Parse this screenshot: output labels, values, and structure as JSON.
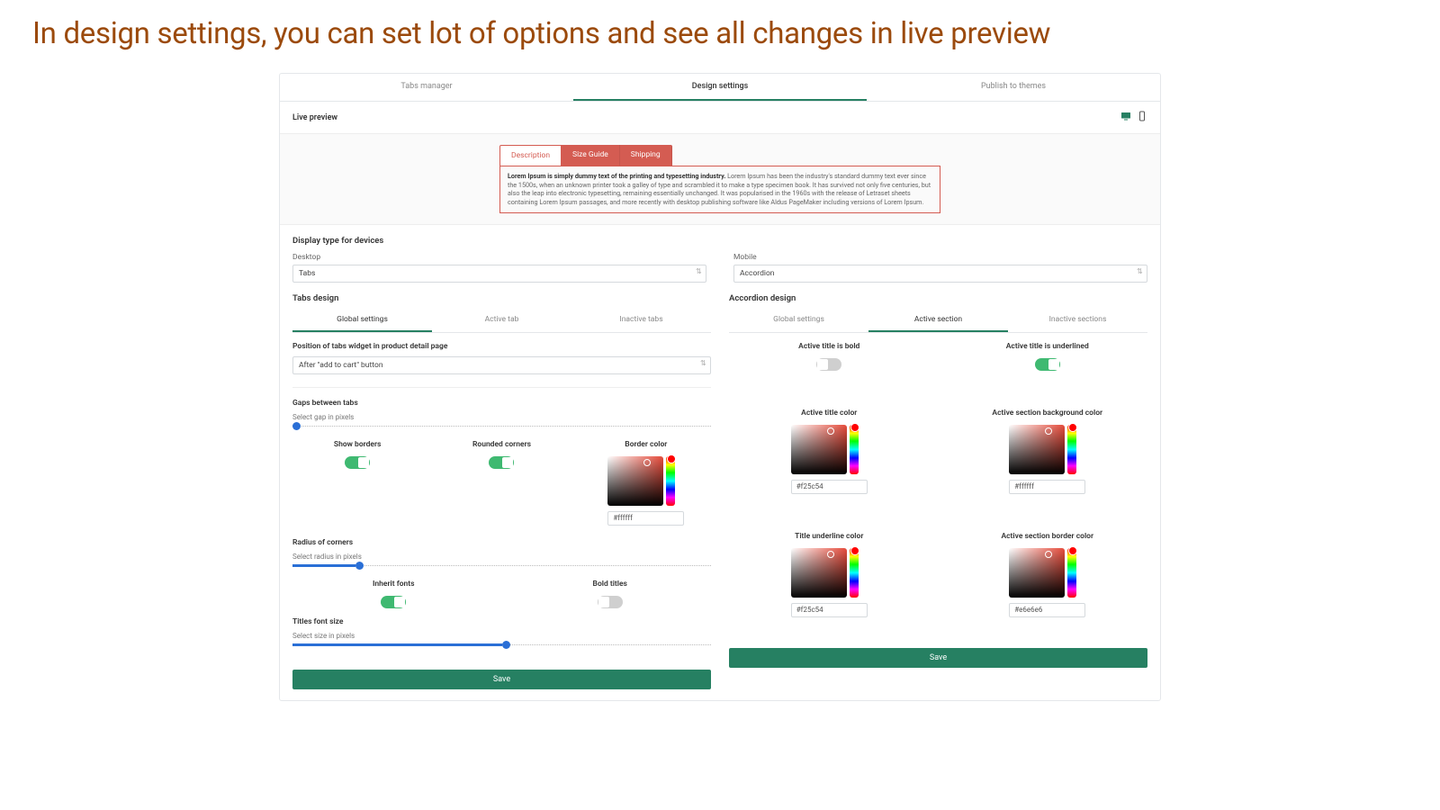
{
  "hero": "In design settings, you can set lot of options and see all changes in live preview",
  "top_tabs": {
    "a": "Tabs manager",
    "b": "Design settings",
    "c": "Publish to themes"
  },
  "live_preview": {
    "title": "Live preview"
  },
  "preview": {
    "tabs": {
      "a": "Description",
      "b": "Size Guide",
      "c": "Shipping"
    },
    "lead": "Lorem Ipsum is simply dummy text of the printing and typesetting industry.",
    "body": " Lorem Ipsum has been the industry's standard dummy text ever since the 1500s, when an unknown printer took a galley of type and scrambled it to make a type specimen book. It has survived not only five centuries, but also the leap into electronic typesetting, remaining essentially unchanged. It was popularised in the 1960s with the release of Letraset sheets containing Lorem Ipsum passages, and more recently with desktop publishing software like Aldus PageMaker including versions of Lorem Ipsum."
  },
  "display_type": {
    "title": "Display type for devices",
    "desktop_lbl": "Desktop",
    "desktop_val": "Tabs",
    "mobile_lbl": "Mobile",
    "mobile_val": "Accordion"
  },
  "tabs_design": {
    "title": "Tabs design",
    "subtabs": {
      "a": "Global settings",
      "b": "Active tab",
      "c": "Inactive tabs"
    },
    "position_title": "Position of tabs widget in product detail page",
    "position_val": "After \"add to cart\" button",
    "gaps_title": "Gaps between tabs",
    "gaps_lbl": "Select gap in pixels",
    "show_borders": "Show borders",
    "rounded": "Rounded corners",
    "border_color": "Border color",
    "border_color_val": "#ffffff",
    "radius_title": "Radius of corners",
    "radius_lbl": "Select radius in pixels",
    "inherit": "Inherit fonts",
    "bold_titles": "Bold titles",
    "font_title": "Titles font size",
    "font_lbl": "Select size in pixels",
    "save": "Save"
  },
  "accordion": {
    "title": "Accordion design",
    "subtabs": {
      "a": "Global settings",
      "b": "Active section",
      "c": "Inactive sections"
    },
    "bold_title": "Active title is bold",
    "underline_title": "Active title is underlined",
    "title_color": "Active title color",
    "title_color_val": "#f25c54",
    "bg_color": "Active section background color",
    "bg_color_val": "#ffffff",
    "underline_color": "Title underline color",
    "underline_color_val": "#f25c54",
    "border_color": "Active section border color",
    "border_color_val": "#e6e6e6",
    "save": "Save"
  }
}
